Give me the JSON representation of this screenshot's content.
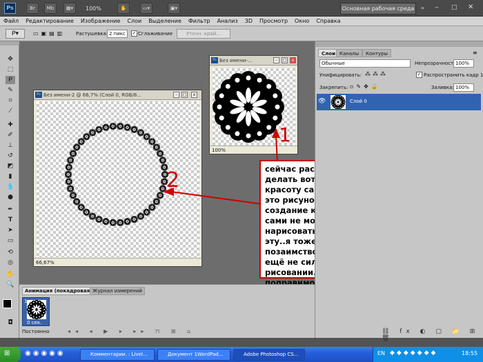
{
  "titlebar": {
    "ps_logo": "Ps",
    "zoom": "100%",
    "workspace_button": "Основная рабочая среда"
  },
  "menu": [
    "Файл",
    "Редактирование",
    "Изображение",
    "Слои",
    "Выделение",
    "Фильтр",
    "Анализ",
    "3D",
    "Просмотр",
    "Окно",
    "Справка"
  ],
  "options": {
    "feather_label": "Растушевка:",
    "feather_value": "2 пикс",
    "antialias_label": "Сглаживание",
    "refine_button": "Уточн. край..."
  },
  "doc1": {
    "title": "Без имени-2 @ 66,7% (Слой 0, RGB/8...",
    "zoom": "66,67%",
    "annotation": "2"
  },
  "doc2": {
    "title": "Без имени-...",
    "zoom": "100%",
    "annotation": "1"
  },
  "panel": {
    "tabs": [
      "Слои",
      "Каналы",
      "Контуры"
    ],
    "blend_mode": "Обычные",
    "opacity_label": "Непрозрачность:",
    "opacity_value": "100%",
    "unify_label": "Унифицировать:",
    "propagate_label": "Распространить кадр 1",
    "lock_label": "Закрепить:",
    "fill_label": "Заливка:",
    "fill_value": "100%",
    "layer_name": "Слой 0"
  },
  "anim": {
    "tab_anim": "Анимация (покадровая)",
    "tab_log": "Журнал измерений",
    "frame_number": "1",
    "frame_delay": "0 сек.",
    "loop": "Постоянно"
  },
  "callout": {
    "text": "сейчас расскажу как делать вот такую красоту самим..первое это рисунок для создание кисти...еслли сами не можете нарисовать ..возьмите эту..я тоже её позаимствовала...сама ещё не сильна в рисовании..но это дело поправимое...."
  },
  "taskbar": {
    "items": [
      "Комментарии. : LiveI...",
      "Документ 1WordPad...",
      "Adobe Photoshop CS..."
    ],
    "lang": "EN",
    "clock": "18:55"
  },
  "colors": {
    "annotation_red": "#d00000",
    "panel_selected": "#3163b0"
  }
}
